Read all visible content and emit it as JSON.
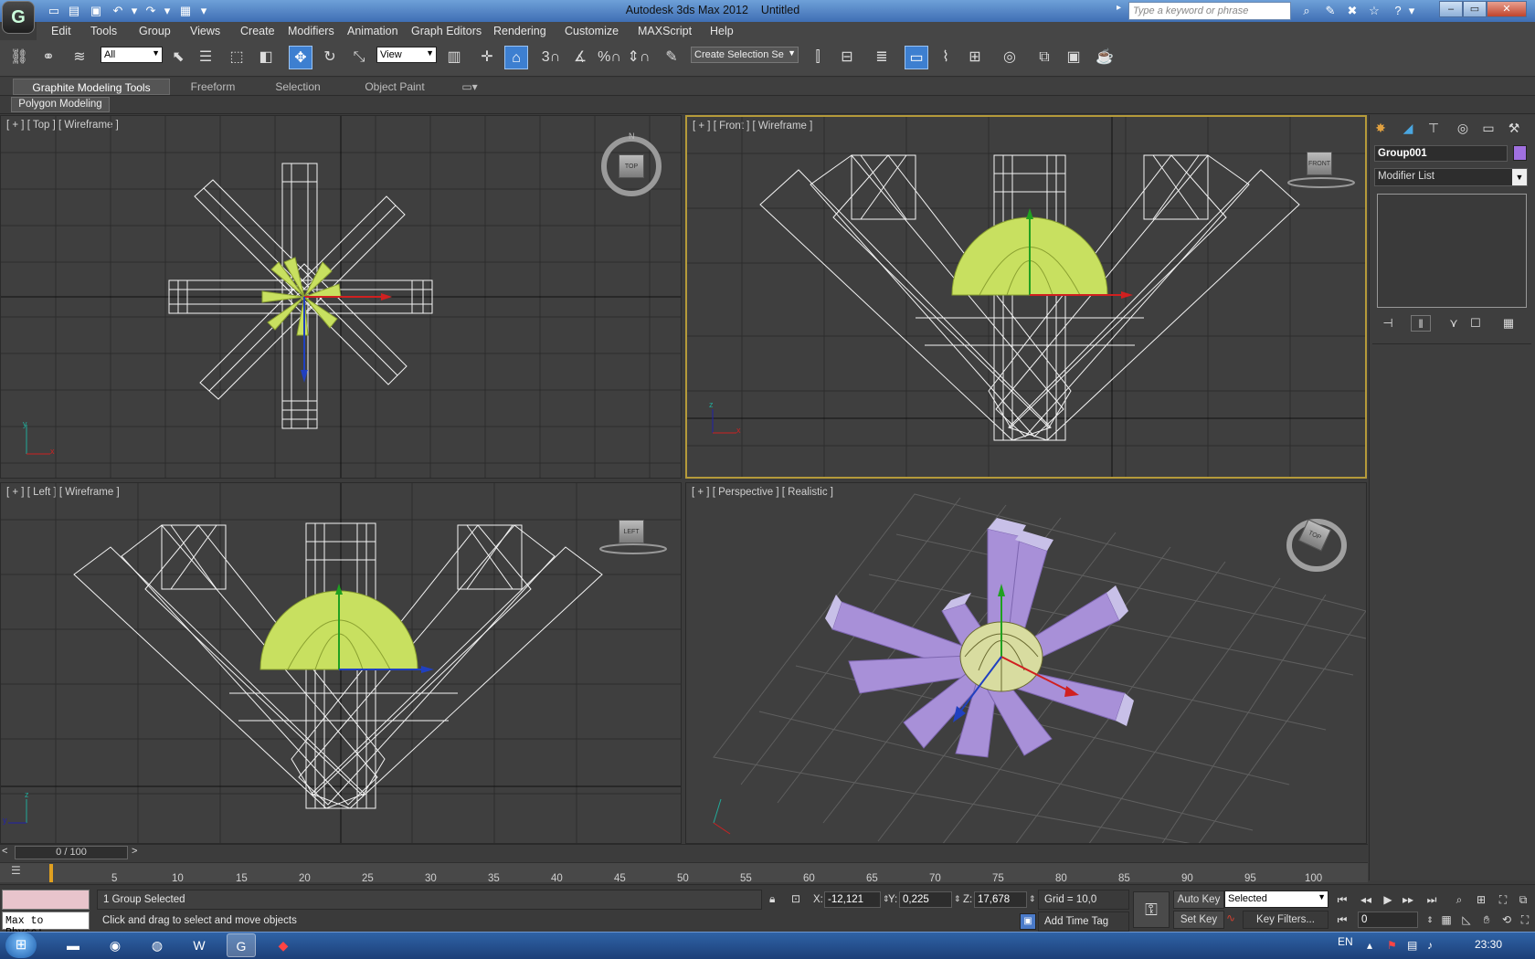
{
  "window": {
    "app_title": "Autodesk 3ds Max  2012",
    "doc_title": "Untitled",
    "search_placeholder": "Type a keyword or phrase",
    "logo": "G"
  },
  "menu": [
    "Edit",
    "Tools",
    "Group",
    "Views",
    "Create",
    "Modifiers",
    "Animation",
    "Graph Editors",
    "Rendering",
    "Customize",
    "MAXScript",
    "Help"
  ],
  "toolbar": {
    "selection_filter": "All",
    "ref_coord": "View",
    "named_selection": "Create Selection Se",
    "snap_labels": [
      "3",
      "",
      "%",
      "a"
    ]
  },
  "ribbon": {
    "tabs": [
      "Graphite Modeling Tools",
      "Freeform",
      "Selection",
      "Object Paint"
    ],
    "active_tab": "Graphite Modeling Tools",
    "panel": "Polygon Modeling"
  },
  "viewports": {
    "top": {
      "label": "[ + ] [ Top ] [ Wireframe ]",
      "cube": "TOP"
    },
    "front": {
      "label": "[ + ] [ Front ] [ Wireframe ]",
      "cube": "FRONT"
    },
    "left": {
      "label": "[ + ] [ Left ] [ Wireframe ]",
      "cube": "LEFT"
    },
    "perspective": {
      "label": "[ + ] [ Perspective ] [ Realistic ]",
      "cube": "TOP"
    }
  },
  "command_panel": {
    "object_name": "Group001",
    "object_color": "#a070e0",
    "modifier_list": "Modifier List"
  },
  "timeline": {
    "frame_display": "0 / 100",
    "ticks": [
      "5",
      "10",
      "15",
      "20",
      "25",
      "30",
      "35",
      "40",
      "45",
      "50",
      "55",
      "60",
      "65",
      "70",
      "75",
      "80",
      "85",
      "90",
      "95",
      "100"
    ]
  },
  "status": {
    "maxscript_text": "Max to Physc:",
    "selection_info": "1 Group Selected",
    "prompt": "Click and drag to select and move objects",
    "x_label": "X:",
    "x_value": "-12,121",
    "y_label": "Y:",
    "y_value": "0,225",
    "z_label": "Z:",
    "z_value": "17,678",
    "grid": "Grid = 10,0",
    "add_time_tag": "Add Time Tag",
    "auto_key": "Auto Key",
    "key_mode": "Selected",
    "set_key": "Set Key",
    "key_filters": "Key Filters...",
    "current_frame": "0"
  },
  "taskbar": {
    "lang": "EN",
    "clock": "23:30",
    "apps": [
      "file-explorer",
      "media-player",
      "chrome",
      "word",
      "3dsmax",
      "acrobat"
    ]
  },
  "colors": {
    "selection_wire": "#c8e060",
    "object_purple": "#a890d8",
    "active_viewport": "#b59a3a"
  }
}
